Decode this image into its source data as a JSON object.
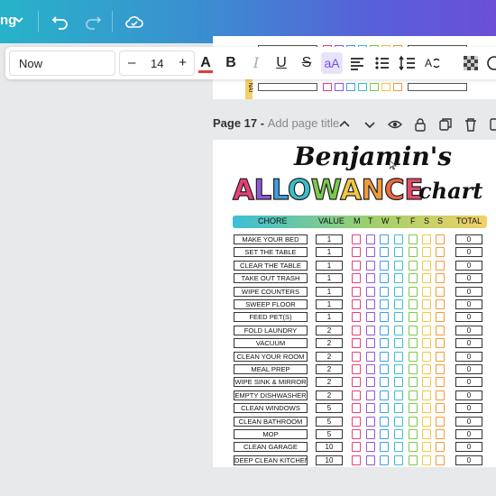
{
  "topbar": {
    "partial_label": "ng",
    "icons": [
      "chevron-down-icon",
      "undo-icon",
      "redo-icon",
      "cloud-saved-icon"
    ]
  },
  "toolbar": {
    "font_name": "Now",
    "font_size": "14",
    "minus": "–",
    "plus": "+",
    "text_color_label": "A",
    "bold_label": "B",
    "italic_label": "I",
    "underline_label": "U",
    "strike_label": "S",
    "case_label": "aA",
    "text_color": "#e33b3b"
  },
  "prev_page": {
    "side_label": "NAI"
  },
  "page_header": {
    "page_label": "Page 17 - ",
    "title_placeholder": "Add page title"
  },
  "document": {
    "title_line1": "Benjamin's",
    "title_word": [
      "A",
      "L",
      "L",
      "O",
      "W",
      "A",
      "N",
      "C",
      "E"
    ],
    "title_colors": [
      "#e8407a",
      "#8f5ad8",
      "#3fa0e0",
      "#3bbfc9",
      "#7cc94d",
      "#f3c744",
      "#f39a3b",
      "#ee6a3b",
      "#e34b6a"
    ],
    "title_line3": "chart",
    "headers": {
      "chore": "CHORE",
      "value": "VALUE",
      "days": [
        "M",
        "T",
        "W",
        "T",
        "F",
        "S",
        "S"
      ],
      "total": "TOTAL"
    },
    "day_colors": [
      "#e8407a",
      "#8f5ad8",
      "#3fa0e0",
      "#3bbfc9",
      "#7cc94d",
      "#f3c744",
      "#f39a3b"
    ],
    "chores": [
      {
        "name": "MAKE YOUR BED",
        "value": "1",
        "total": "0"
      },
      {
        "name": "SET THE TABLE",
        "value": "1",
        "total": "0"
      },
      {
        "name": "CLEAR THE TABLE",
        "value": "1",
        "total": "0"
      },
      {
        "name": "TAKE OUT TRASH",
        "value": "1",
        "total": "0"
      },
      {
        "name": "WIPE COUNTERS",
        "value": "1",
        "total": "0"
      },
      {
        "name": "SWEEP FLOOR",
        "value": "1",
        "total": "0"
      },
      {
        "name": "FEED PET(S)",
        "value": "1",
        "total": "0"
      },
      {
        "name": "FOLD LAUNDRY",
        "value": "2",
        "total": "0"
      },
      {
        "name": "VACUUM",
        "value": "2",
        "total": "0"
      },
      {
        "name": "CLEAN YOUR ROOM",
        "value": "2",
        "total": "0"
      },
      {
        "name": "MEAL PREP",
        "value": "2",
        "total": "0"
      },
      {
        "name": "WIPE SINK & MIRROR",
        "value": "2",
        "total": "0"
      },
      {
        "name": "EMPTY DISHWASHER",
        "value": "2",
        "total": "0"
      },
      {
        "name": "CLEAN WINDOWS",
        "value": "5",
        "total": "0"
      },
      {
        "name": "CLEAN BATHROOM",
        "value": "5",
        "total": "0"
      },
      {
        "name": "MOP",
        "value": "5",
        "total": "0"
      },
      {
        "name": "CLEAN GARAGE",
        "value": "10",
        "total": "0"
      },
      {
        "name": "DEEP CLEAN KITCHEN",
        "value": "10",
        "total": "0"
      }
    ]
  }
}
